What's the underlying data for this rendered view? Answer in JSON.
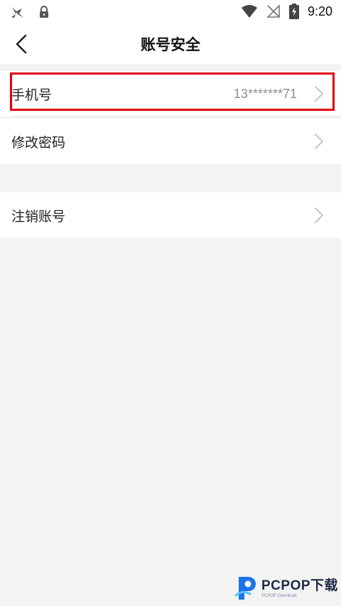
{
  "status_bar": {
    "time": "9:20",
    "icons": [
      "hummingbird-app-icon",
      "lock-icon",
      "wifi-icon",
      "no-signal-icon",
      "battery-charging-icon"
    ]
  },
  "header": {
    "title": "账号安全",
    "back_icon": "chevron-left-icon"
  },
  "settings": {
    "phone": {
      "label": "手机号",
      "value": "13*******71"
    },
    "password": {
      "label": "修改密码"
    },
    "deactivate": {
      "label": "注销账号"
    }
  },
  "highlight": {
    "color": "#e00012"
  },
  "watermark": {
    "text": "PCPOP下载",
    "subtext": "PCPOP Download"
  },
  "colors": {
    "background": "#f3f3f3",
    "card": "#ffffff",
    "value_text": "#8e8e8e",
    "chevron": "#bfbfbf"
  }
}
